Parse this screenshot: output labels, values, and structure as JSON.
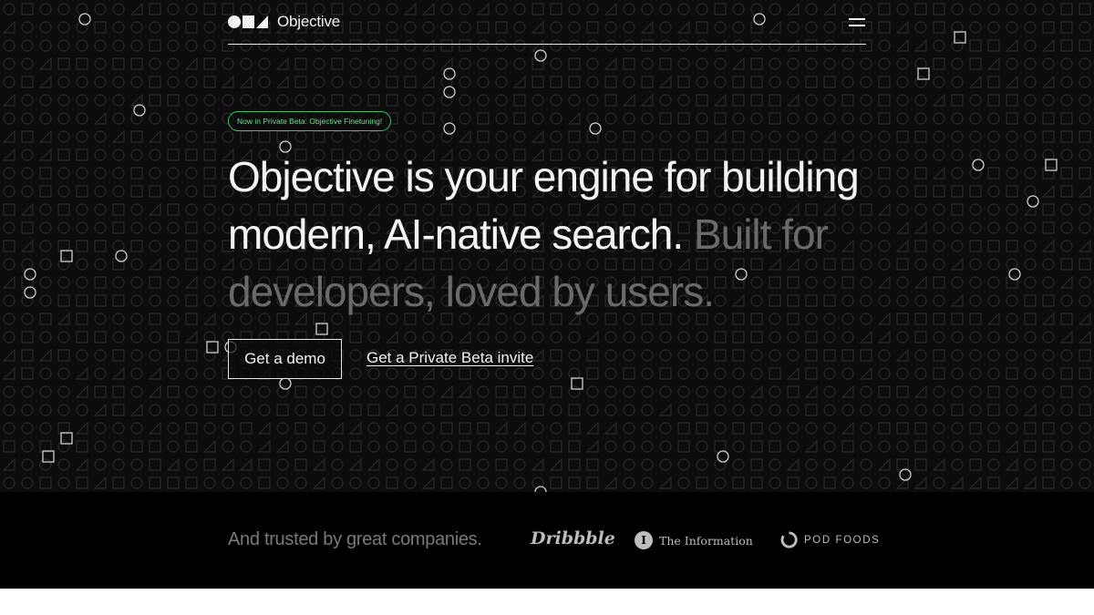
{
  "header": {
    "logo_text": "Objective",
    "menu_icon": "hamburger-menu-icon"
  },
  "hero": {
    "badge": "Now in Private Beta: Objective Finetuning!",
    "headline_main": "Objective is your engine for building modern, AI-native search.",
    "headline_muted": " Built for developers, loved by users.",
    "cta_primary": "Get a demo",
    "cta_secondary": "Get a Private Beta invite"
  },
  "trust": {
    "text": "And trusted by great companies.",
    "logos": {
      "dribbble": "Dribbble",
      "the_information": "The Information",
      "the_information_mark": "I",
      "pod_foods": "POD FOODS"
    }
  },
  "colors": {
    "background": "#0c0c0c",
    "pattern": "#2b2b2b",
    "accent_green": "#3fbf6a",
    "text": "#f2f2f2",
    "muted": "#6a6a6a"
  }
}
